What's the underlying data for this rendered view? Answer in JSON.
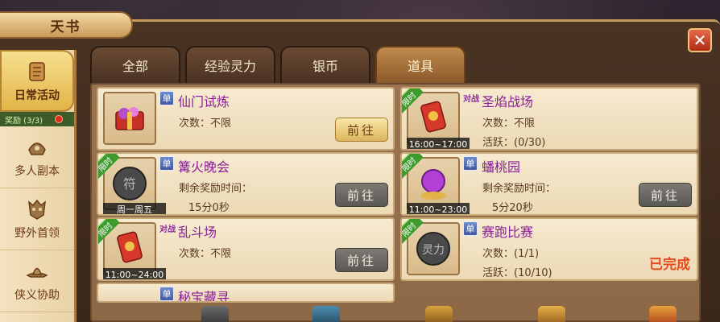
{
  "window": {
    "title": "天书",
    "close": "✕"
  },
  "sidebar": {
    "items": [
      {
        "label": "日常活动",
        "icon": "scroll-icon",
        "active": true
      },
      {
        "label": "多人副本",
        "icon": "helmet-icon",
        "active": false
      },
      {
        "label": "野外首领",
        "icon": "demon-mask-icon",
        "active": false
      },
      {
        "label": "侠义协助",
        "icon": "hat-icon",
        "active": false
      }
    ],
    "reward": "奖励 (3/3)"
  },
  "tabs": [
    {
      "label": "全部",
      "active": false
    },
    {
      "label": "经验灵力",
      "active": false
    },
    {
      "label": "银币",
      "active": false
    },
    {
      "label": "道具",
      "active": true
    }
  ],
  "cards": [
    {
      "title": "仙门试炼",
      "badge": "单",
      "line1": "次数：不限",
      "line2": "",
      "limited": false,
      "time": "",
      "action": "前往",
      "action_style": "yellow",
      "icon": "gift-package-icon"
    },
    {
      "title": "圣焰战场",
      "badge": "对战",
      "line1": "次数：不限",
      "line2": "活跃：(0/30)",
      "limited": true,
      "limited_label": "限时",
      "time": "16:00~17:00",
      "action": "",
      "action_style": "none",
      "icon": "talisman-icon"
    },
    {
      "title": "篝火晚会",
      "badge": "单",
      "line1": "剩余奖励时间：",
      "line2": "15分0秒",
      "limited": true,
      "limited_label": "限时",
      "time": "周一周五",
      "action": "前往",
      "action_style": "gray",
      "icon": "stone-token-icon"
    },
    {
      "title": "蟠桃园",
      "badge": "单",
      "line1": "剩余奖励时间：",
      "line2": "5分20秒",
      "limited": true,
      "limited_label": "限时",
      "time": "11:00~23:00",
      "action": "前往",
      "action_style": "gray",
      "icon": "purple-orb-icon"
    },
    {
      "title": "乱斗场",
      "badge": "对战",
      "line1": "次数：不限",
      "line2": "",
      "limited": true,
      "limited_label": "限时",
      "time": "11:00~24:00",
      "action": "前往",
      "action_style": "gray",
      "icon": "talisman-icon"
    },
    {
      "title": "赛跑比赛",
      "badge": "单",
      "line1": "次数：(1/1)",
      "line2": "活跃：(10/10)",
      "limited": true,
      "limited_label": "限时",
      "time": "",
      "action": "",
      "action_style": "done",
      "done_text": "已完成",
      "icon": "stone-token-icon"
    },
    {
      "title": "秘宝藏寻",
      "badge": "单",
      "partial": true
    }
  ],
  "colors": {
    "title_purple": "#8a1d9a",
    "done_red": "#e84a1d",
    "ribbon_green": "#3d9a2c",
    "badge_blue": "#4a63aa"
  }
}
